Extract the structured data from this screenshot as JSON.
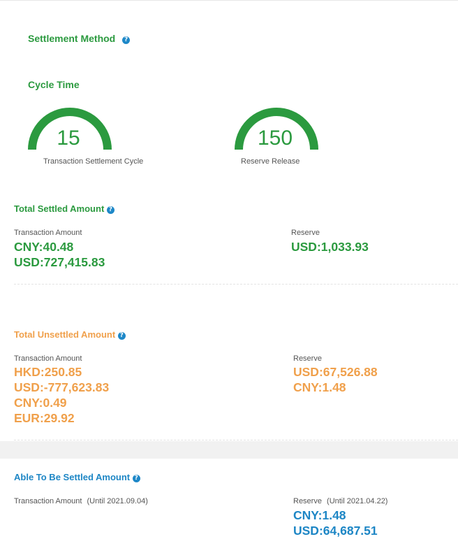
{
  "settlement_method": {
    "title": "Settlement Method",
    "help_icon": "?"
  },
  "cycle_time": {
    "title": "Cycle Time",
    "gauges": [
      {
        "value": "15",
        "label": "Transaction Settlement Cycle"
      },
      {
        "value": "150",
        "label": "Reserve Release"
      }
    ]
  },
  "total_settled": {
    "title": "Total Settled Amount",
    "help_icon": "?",
    "transaction_label": "Transaction Amount",
    "transaction_amounts": [
      "CNY:40.48",
      "USD:727,415.83"
    ],
    "reserve_label": "Reserve",
    "reserve_amounts": [
      "USD:1,033.93"
    ],
    "color": "#2b9a3f"
  },
  "total_unsettled": {
    "title": "Total Unsettled Amount",
    "help_icon": "?",
    "transaction_label": "Transaction Amount",
    "transaction_amounts": [
      "HKD:250.85",
      "USD:-777,623.83",
      "CNY:0.49",
      "EUR:29.92"
    ],
    "reserve_label": "Reserve",
    "reserve_amounts": [
      "USD:67,526.88",
      "CNY:1.48"
    ],
    "color": "#f0a04b"
  },
  "able_to_settle": {
    "title": "Able To Be Settled Amount",
    "help_icon": "?",
    "transaction_label": "Transaction Amount",
    "transaction_until": "(Until 2021.09.04)",
    "reserve_label": "Reserve",
    "reserve_until": "(Until 2021.04.22)",
    "reserve_amounts": [
      "CNY:1.48",
      "USD:64,687.51"
    ],
    "color": "#1d86c5"
  }
}
